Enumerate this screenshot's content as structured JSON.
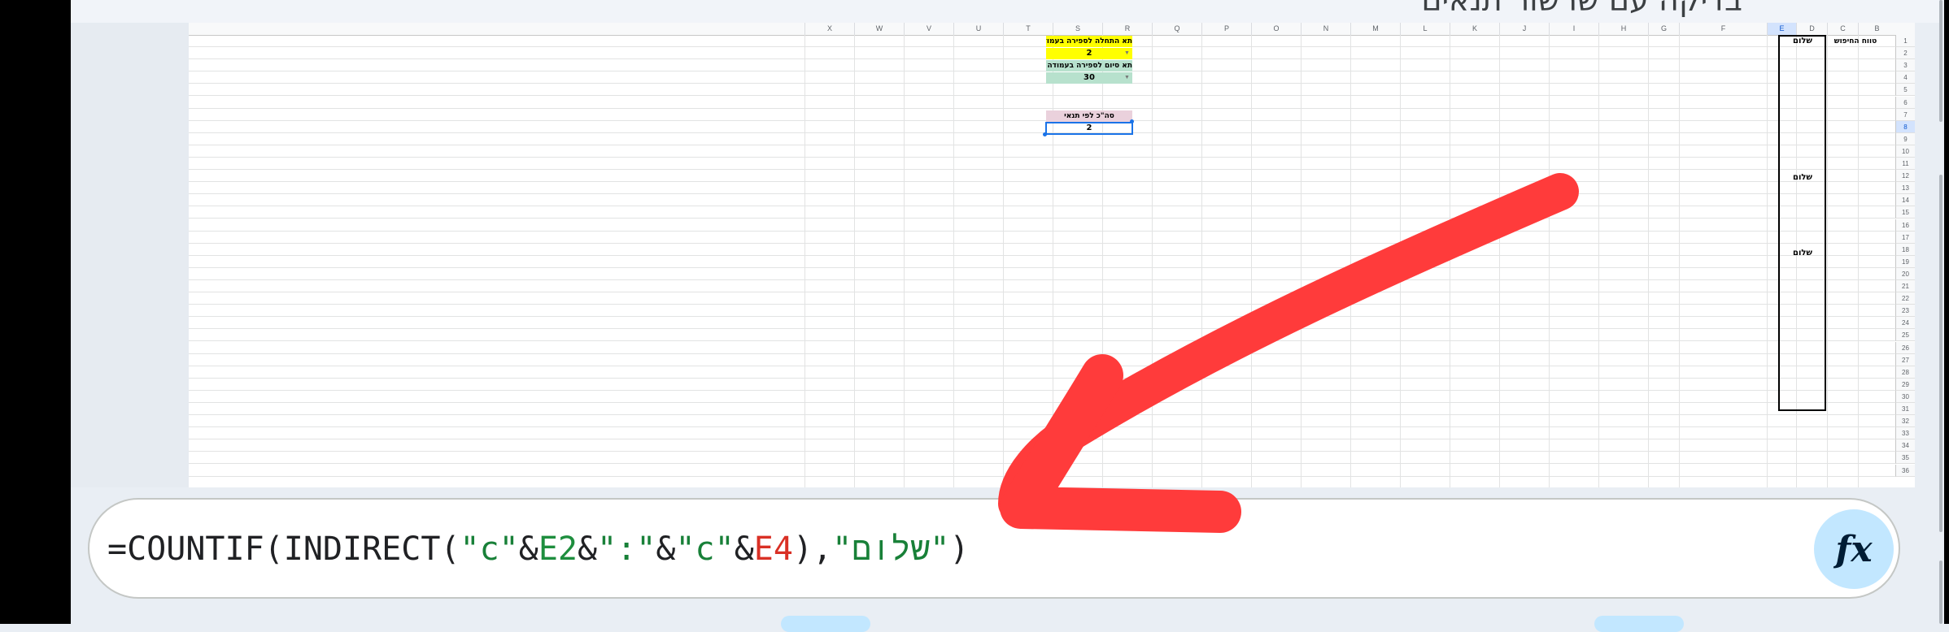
{
  "page_title": "בדיקה עם שרשור תנאים",
  "columns": [
    "X",
    "W",
    "V",
    "U",
    "T",
    "S",
    "R",
    "Q",
    "P",
    "O",
    "N",
    "M",
    "L",
    "K",
    "J",
    "I",
    "H",
    "G",
    "F",
    "E",
    "D",
    "C",
    "B"
  ],
  "selected_column": "E",
  "rows": [
    "1",
    "2",
    "3",
    "4",
    "5",
    "6",
    "7",
    "8",
    "9",
    "10",
    "11",
    "12",
    "13",
    "14",
    "15",
    "16",
    "17",
    "18",
    "19",
    "20",
    "21",
    "22",
    "23",
    "24",
    "25",
    "26",
    "27",
    "28",
    "29",
    "30",
    "31",
    "32",
    "33",
    "34",
    "35",
    "36"
  ],
  "selected_row": "8",
  "cells": {
    "e1": "תא התחלה לספירה בעמודה C",
    "e2": "2",
    "e3": "תא סיום לספירה בעמודה C",
    "e4": "30",
    "e7": "סה\"כ לפי תנאי",
    "e8": "2",
    "b1": "טווח החיפוש",
    "c1": "שלום",
    "c12": "שלום",
    "c18": "שלום"
  },
  "colors": {
    "e1_bg": "#ffff00",
    "e2_bg": "#ffff00",
    "e3_bg": "#b7e1cd",
    "e4_bg": "#b7e1cd",
    "e7_bg": "#ead1dc",
    "annotation_arrow": "#ff3b3b"
  },
  "formula_bar": {
    "prefix": "=COUNTIF(INDIRECT(",
    "s1": "\"c\"",
    "amp1": "&",
    "ref1": "E2",
    "amp2": "&",
    "s2": "\":\"",
    "amp3": "&",
    "s3": "\"c\"",
    "amp4": "&",
    "ref2": "E4",
    "close1": "),",
    "s4": "\"שלום\"",
    "close2": ")",
    "fx_label": "fx"
  },
  "icons": {
    "fx_button": "function-icon",
    "dropdown": "chevron-down-icon"
  }
}
